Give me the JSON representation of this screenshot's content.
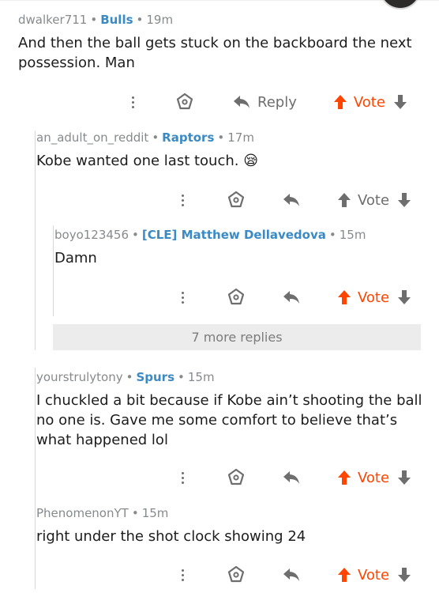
{
  "comments": [
    {
      "username": "dwalker711",
      "flair": "Bulls",
      "time": "19m",
      "text": "And then the ball gets stuck on the backboard the next possession. Man",
      "reply_label": "Reply",
      "vote_label": "Vote"
    },
    {
      "username": "an_adult_on_reddit",
      "flair": "Raptors",
      "time": "17m",
      "text": "Kobe wanted one last touch.",
      "emoji": "😪",
      "vote_label": "Vote"
    },
    {
      "username": "boyo123456",
      "flair": "[CLE] Matthew Dellavedova",
      "time": "15m",
      "text": "Damn",
      "vote_label": "Vote"
    },
    {
      "username": "yourstrulytony",
      "flair": "Spurs",
      "time": "15m",
      "text": "I chuckled a bit because if Kobe ain’t shooting the ball no one is. Gave me some comfort to believe that’s what happened lol",
      "vote_label": "Vote"
    },
    {
      "username": "PhenomenonYT",
      "flair": "",
      "time": "15m",
      "text": "right under the shot clock showing 24",
      "vote_label": "Vote"
    }
  ],
  "more_replies_label": "7 more replies",
  "colors": {
    "upvote": "#ff4500",
    "flair": "#3b8ac4",
    "meta": "#878a8c",
    "icon": "#6e6e6e"
  },
  "icons": {
    "more": "more-vertical-icon",
    "award": "award-icon",
    "reply": "reply-arrow-icon",
    "upvote": "upvote-arrow-icon",
    "downvote": "downvote-arrow-icon"
  }
}
